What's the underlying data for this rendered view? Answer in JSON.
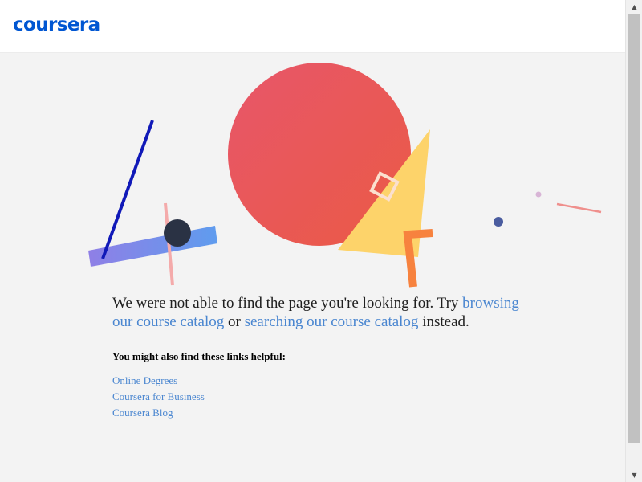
{
  "header": {
    "logo_text": "coursera"
  },
  "illustration": {
    "colors": {
      "circle_start": "#e8566a",
      "circle_end": "#ea5a45",
      "triangle": "#fdd36a",
      "blue_line": "#1019b8",
      "bar_start": "#8f7fe6",
      "bar_end": "#5f9cee",
      "dark_circle": "#2a3244",
      "pink": "#f4aaaa",
      "orange": "#f7823e",
      "small_dot": "#4a5c9f",
      "tiny_dot": "#d8b5d6",
      "salmon_line": "#ef8f8c"
    }
  },
  "message": {
    "text_before": "We were not able to find the page you're looking for. Try",
    "link_browse": "browsing our course catalog",
    "text_or": "or",
    "link_search": "searching our course catalog",
    "text_after": "instead."
  },
  "helpful": {
    "heading": "You might also find these links helpful:",
    "links": [
      {
        "label": "Online Degrees"
      },
      {
        "label": "Coursera for Business"
      },
      {
        "label": "Coursera Blog"
      }
    ]
  },
  "scrollbar": {
    "up_icon": "▲",
    "down_icon": "▼"
  }
}
